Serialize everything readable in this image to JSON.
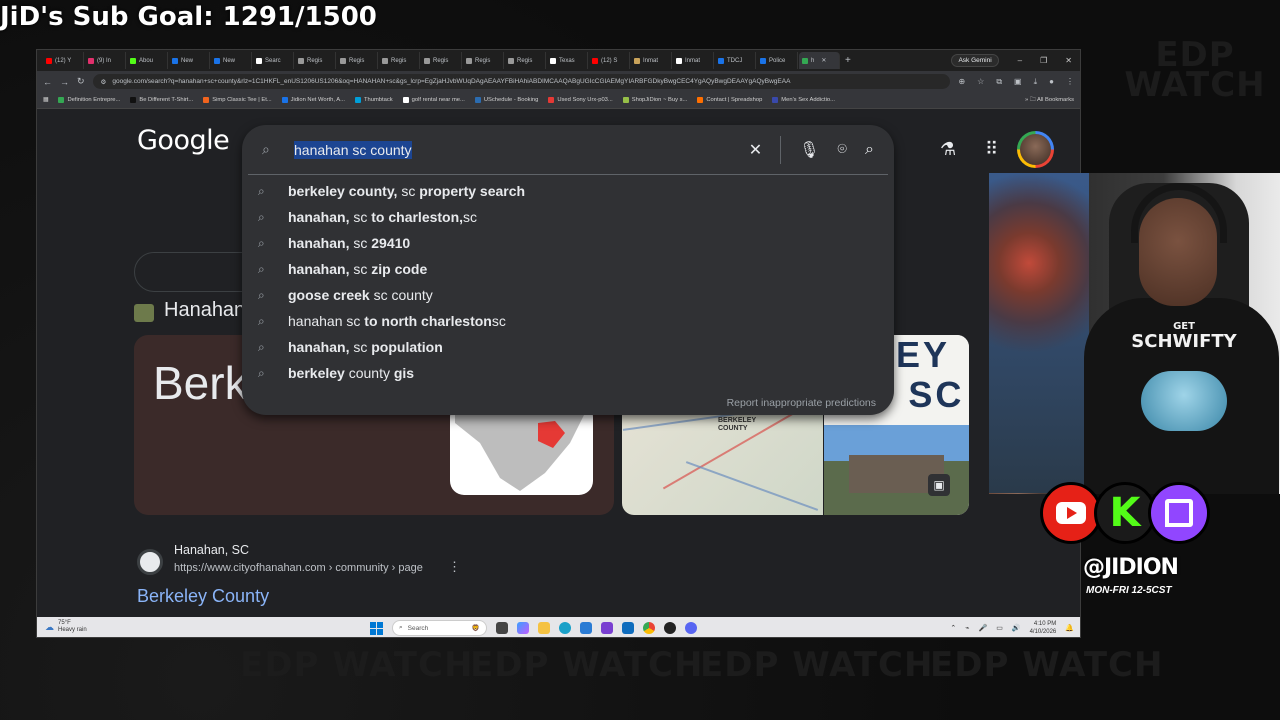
{
  "overlay": {
    "sub_goal": "JiD's Sub Goal: 1291/1500",
    "handle": "@JIDION",
    "schedule": "MON-FRI 12-5CST",
    "watermark": "EDP WATCH",
    "shirt_line1": "GET",
    "shirt_line2": "SCHWIFTY"
  },
  "browser": {
    "tabs": [
      {
        "label": "(12) Y",
        "color": "#ff0000"
      },
      {
        "label": "(9) In",
        "color": "#e1306c"
      },
      {
        "label": "Abou",
        "color": "#53fc18"
      },
      {
        "label": "New",
        "color": "#1a73e8"
      },
      {
        "label": "New",
        "color": "#1a73e8"
      },
      {
        "label": "Searc",
        "color": "#ffffff"
      },
      {
        "label": "Regis",
        "color": "#999999"
      },
      {
        "label": "Regis",
        "color": "#999999"
      },
      {
        "label": "Regis",
        "color": "#999999"
      },
      {
        "label": "Regis",
        "color": "#999999"
      },
      {
        "label": "Regis",
        "color": "#999999"
      },
      {
        "label": "Regis",
        "color": "#999999"
      },
      {
        "label": "Texas",
        "color": "#ffffff"
      },
      {
        "label": "(12) S",
        "color": "#ff0000"
      },
      {
        "label": "Inmat",
        "color": "#c9a35a"
      },
      {
        "label": "Inmat",
        "color": "#ffffff"
      },
      {
        "label": "TDCJ",
        "color": "#1a73e8"
      },
      {
        "label": "Police",
        "color": "#1a73e8"
      },
      {
        "label": "h",
        "color": "#34a853"
      }
    ],
    "new_tab": "+",
    "ask_gemini": "Ask Gemini",
    "url": "google.com/search?q=hanahan+sc+county&rlz=1C1HKFL_enUS1206US1206&oq=HANAHAN+sc&gs_lcrp=EgZjaHJvbWUqDAgAEAAYFBiHAhiABDIMCAAQABgUGIcCGIAEMgYIARBFGDkyBwgCEC4YgAQyBwgDEAAYgAQyBwgEAA",
    "bookmarks": [
      {
        "label": "Definition Entrepre...",
        "color": "#34a853"
      },
      {
        "label": "Be Different T-Shirt...",
        "color": "#111111"
      },
      {
        "label": "Simp Classic Tee | Et...",
        "color": "#f1641e"
      },
      {
        "label": "Jidion Net Worth, A...",
        "color": "#1a73e8"
      },
      {
        "label": "Thumbtack",
        "color": "#009fd9"
      },
      {
        "label": "golf rental near me...",
        "color": "#ffffff"
      },
      {
        "label": "USchedule - Booking",
        "color": "#2b6cb0"
      },
      {
        "label": "Used Sony Urx-p03...",
        "color": "#e53935"
      },
      {
        "label": "ShopJiDion ~ Buy s...",
        "color": "#96bf48"
      },
      {
        "label": "Contact | Spreadshop",
        "color": "#ff6f00"
      },
      {
        "label": "Men's Sex Addictio...",
        "color": "#3949ab"
      }
    ],
    "all_bookmarks": "All Bookmarks"
  },
  "google": {
    "logo": "Google",
    "query": "hanahan sc county",
    "suggestions": [
      {
        "bold": "berkeley county,",
        "normal": " sc ",
        "bold2": "property search",
        "normal2": ""
      },
      {
        "bold": "hanahan,",
        "normal": " sc ",
        "bold2": "to charleston,",
        "normal2": " sc"
      },
      {
        "bold": "hanahan,",
        "normal": " sc ",
        "bold2": "29410",
        "normal2": ""
      },
      {
        "bold": "hanahan,",
        "normal": " sc ",
        "bold2": "zip code",
        "normal2": ""
      },
      {
        "bold": "goose creek",
        "normal": " sc county",
        "bold2": "",
        "normal2": ""
      },
      {
        "bold": "",
        "normal": "hanahan sc ",
        "bold2": "to north charleston",
        "normal2": " sc"
      },
      {
        "bold": "hanahan,",
        "normal": " sc ",
        "bold2": "population",
        "normal2": ""
      },
      {
        "bold": "berkeley",
        "normal": " county ",
        "bold2": "gis",
        "normal2": ""
      }
    ],
    "report": "Report inappropriate predictions",
    "knowledge_title": "Hanahan",
    "card_text": "Berkeley County",
    "card_image_text": "ELEY TY SC",
    "map_label": "BERKELEY COUNTY",
    "result": {
      "site": "Hanahan, SC",
      "url": "https://www.cityofhanahan.com › community › page",
      "title": "Berkeley County"
    }
  },
  "taskbar": {
    "temp": "75°F",
    "weather": "Heavy rain",
    "search": "Search",
    "time": "4:10 PM",
    "date": "4/10/2026"
  }
}
